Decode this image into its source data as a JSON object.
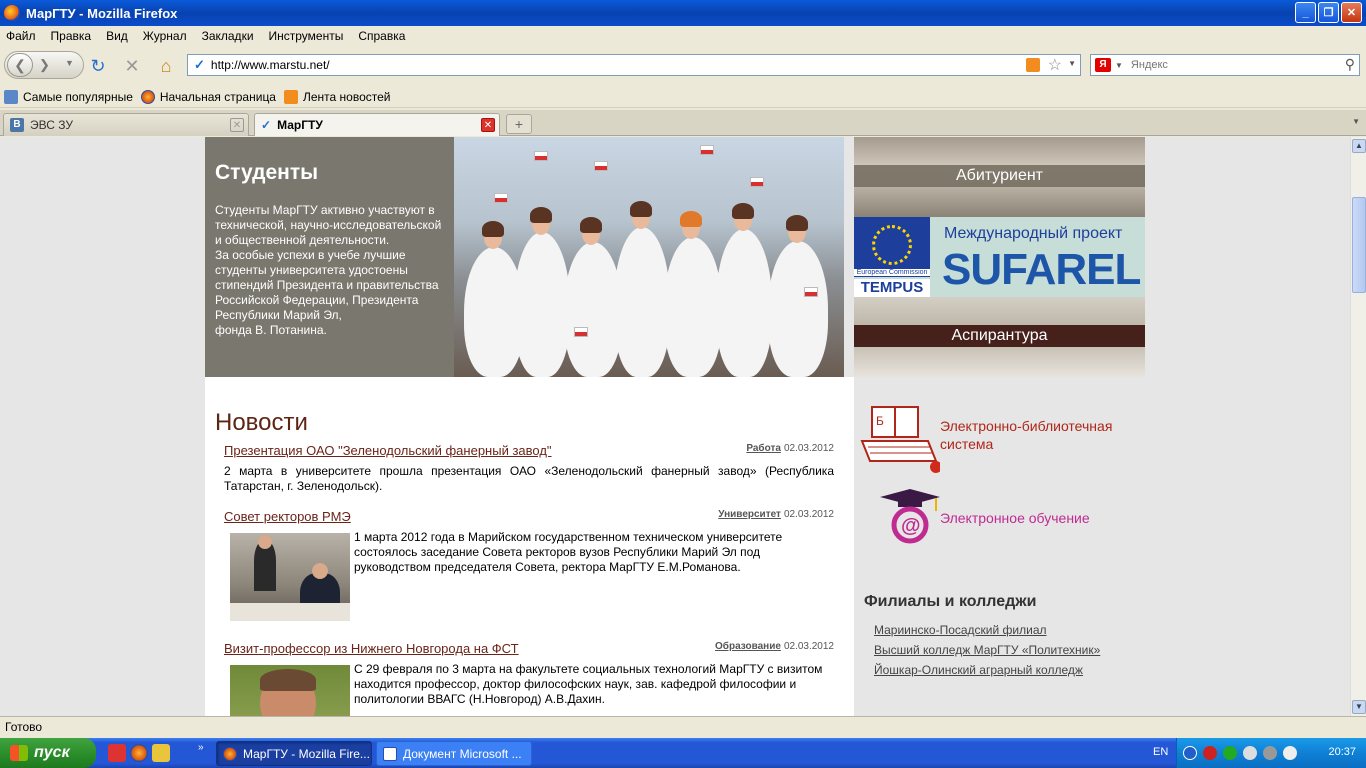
{
  "window": {
    "title": "МарГТУ - Mozilla Firefox",
    "controls": [
      "_",
      "❐",
      "✕"
    ]
  },
  "menu": [
    "Файл",
    "Правка",
    "Вид",
    "Журнал",
    "Закладки",
    "Инструменты",
    "Справка"
  ],
  "nav": {
    "url": "http://www.marstu.net/",
    "search_placeholder": "Яндекс",
    "search_engine": "Я"
  },
  "bookmarks": [
    "Самые популярные",
    "Начальная страница",
    "Лента новостей"
  ],
  "tabs": [
    {
      "label": "ЭВС ЗУ",
      "icon": "В",
      "active": false
    },
    {
      "label": "МарГТУ",
      "active": true
    }
  ],
  "hero": {
    "title": "Студенты",
    "text": "Студенты МарГТУ активно участвуют в технической,  научно-исследовательской и общественной деятельности.\nЗа особые успехи в учебе лучшие студенты университета удостоены стипендий Президента и правительства Российской Федерации, Президента Республики Марий Эл,\nфонда В. Потанина."
  },
  "banners": {
    "abit": "Абитуриент",
    "intl": "Международный проект",
    "sufarel": "SUFAREL",
    "eu_caption": "European Commission",
    "tempus": "TEMPUS",
    "asp": "Аспирантура"
  },
  "news": {
    "title": "Новости",
    "items": [
      {
        "headline": "Презентация ОАО \"Зеленодольский фанерный завод\"",
        "category": "Работа",
        "date": "02.03.2012",
        "body": "2 марта в университете прошла презентация ОАО «Зеленодольский фанерный завод» (Республика Татарстан, г. Зеленодольск)."
      },
      {
        "headline": "Совет ректоров РМЭ",
        "category": "Университет",
        "date": "02.03.2012",
        "body": "1 марта 2012 года в Марийском государственном техническом университете состоялось заседание Совета ректоров вузов Республики Марий Эл под руководством председателя Совета, ректора МарГТУ Е.М.Романова."
      },
      {
        "headline": "Визит-профессор из Нижнего Новгорода на ФСТ",
        "category": "Образование",
        "date": "02.03.2012",
        "body": "С 29 февраля по 3 марта на факультете социальных технологий МарГТУ с визитом находится  профессор, доктор философских наук, зав. кафедрой философии и политологии ВВАГС (Н.Новгород) А.В.Дахин."
      }
    ]
  },
  "sidebar": {
    "library": "Электронно-библиотечная\nсистема",
    "elearning": "Электронное обучение",
    "branches_title": "Филиалы и колледжи",
    "branches": [
      "Мариинско-Посадский филиал",
      "Высший колледж МарГТУ «Политехник»",
      "Йошкар-Олинский аграрный колледж"
    ]
  },
  "status": "Готово",
  "taskbar": {
    "start": "пуск",
    "windows": [
      "МарГТУ - Mozilla Fire...",
      "Документ Microsoft ..."
    ],
    "lang": "EN",
    "clock": "20:37"
  },
  "colors": {
    "titlebar": "#0842b0",
    "news_head": "#6b2418",
    "library_text": "#b0261a",
    "elearning_text": "#c02b92",
    "hero_bg": "#7a776e"
  }
}
